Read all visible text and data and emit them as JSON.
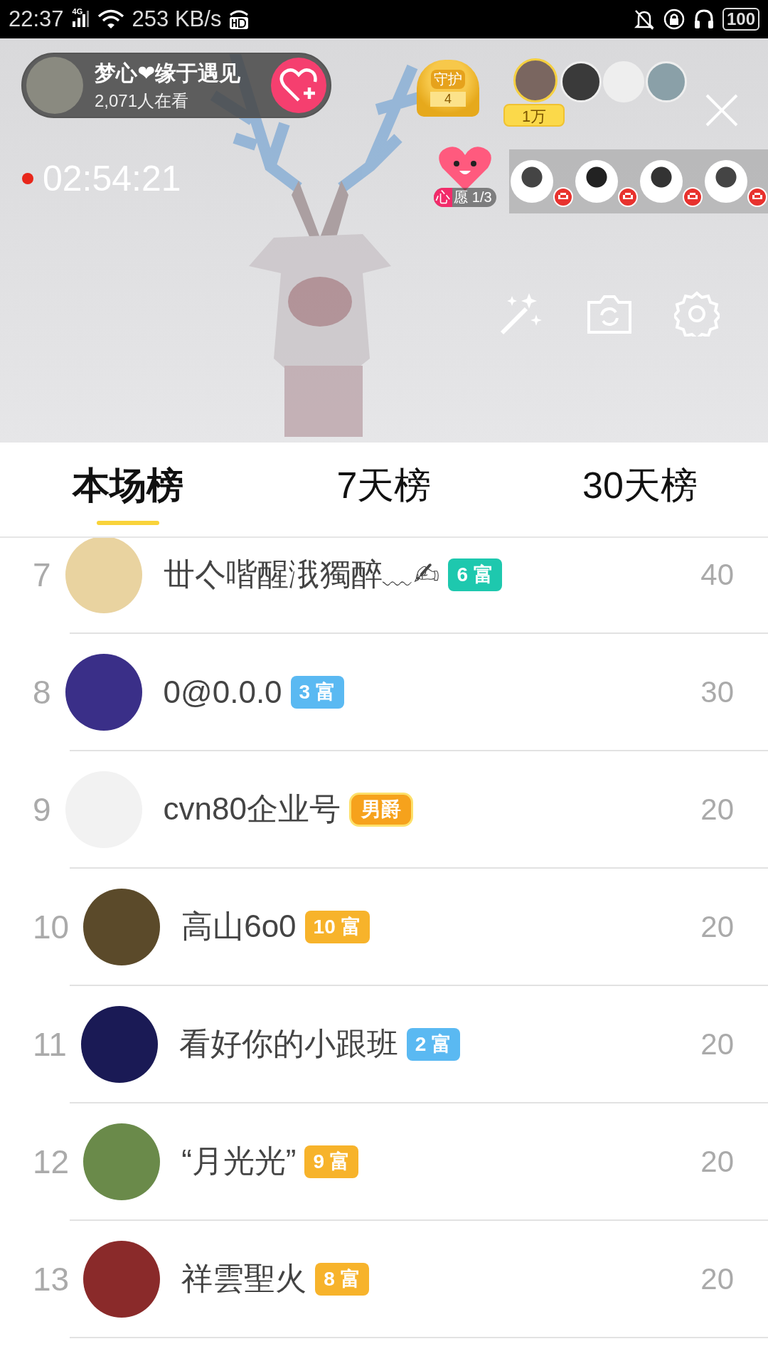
{
  "status_bar": {
    "time": "22:37",
    "network": "4G",
    "speed": "253 KB/s",
    "battery": "100"
  },
  "live": {
    "host_name": "梦心❤缘于遇见",
    "viewers": "2,071人在看",
    "guard_label": "守护",
    "guard_count": "4",
    "top_viewer_amount": "1万",
    "timer": "02:54:21",
    "wish": {
      "mark": "心",
      "count": "愿 1/3"
    }
  },
  "tabs": [
    {
      "label": "本场榜",
      "selected": true
    },
    {
      "label": "7天榜",
      "selected": false
    },
    {
      "label": "30天榜",
      "selected": false
    }
  ],
  "ranking": [
    {
      "rank": "7",
      "name": "丗亽喈醒涐獨醉﹏✍",
      "badge": {
        "kind": "wealth",
        "text": "6 富",
        "color": "#1ec8ae"
      },
      "score": "40"
    },
    {
      "rank": "8",
      "name": "0@0.0.0",
      "badge": {
        "kind": "wealth",
        "text": "3 富",
        "color": "#5ab9f2"
      },
      "score": "30"
    },
    {
      "rank": "9",
      "name": "cvn80企业号",
      "badge": {
        "kind": "noble",
        "text": "男爵",
        "color": "#f6a21c"
      },
      "score": "20"
    },
    {
      "rank": "10",
      "name": "高山6o0",
      "badge": {
        "kind": "wealth",
        "text": "10 富",
        "color": "#f7b32b"
      },
      "score": "20"
    },
    {
      "rank": "11",
      "name": "看好你的小跟班",
      "badge": {
        "kind": "wealth",
        "text": "2 富",
        "color": "#5ab9f2"
      },
      "score": "20"
    },
    {
      "rank": "12",
      "name": "“月光光”",
      "badge": {
        "kind": "wealth",
        "text": "9 富",
        "color": "#f7b32b"
      },
      "score": "20"
    },
    {
      "rank": "13",
      "name": "祥雲聖火",
      "badge": {
        "kind": "wealth",
        "text": "8 富",
        "color": "#f7b32b"
      },
      "score": "20"
    }
  ]
}
